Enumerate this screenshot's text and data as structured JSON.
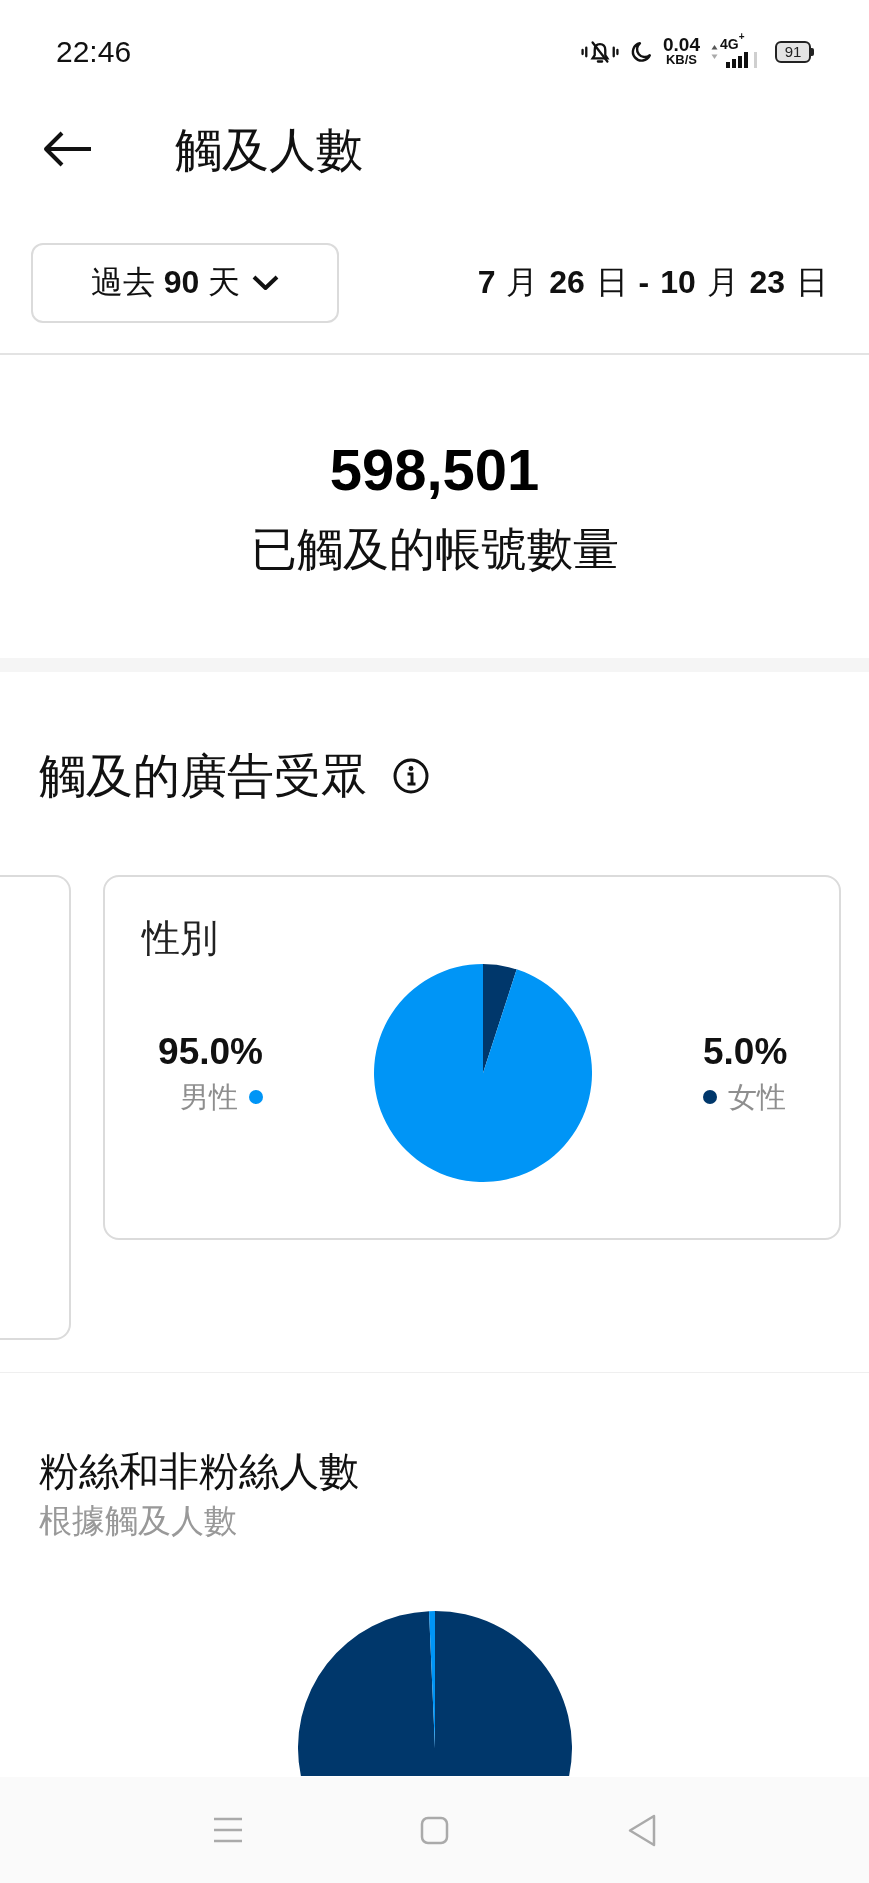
{
  "status_bar": {
    "time": "22:46",
    "speed": "0.04",
    "speed_unit": "KB/S",
    "network": "4G$^{+}$",
    "battery": "91"
  },
  "header": {
    "title": "觸及人數"
  },
  "filter": {
    "range": "過去 **90** 天",
    "dates": "**7** 月 **26** 日 **-** **10** 月 **23** 日"
  },
  "summary": {
    "value": "598,501",
    "label": "已觸及的帳號數量"
  },
  "audience": {
    "title": "觸及的廣告受眾",
    "gender": {
      "title": "性別",
      "chart_data": {
        "type": "pie",
        "categories": [
          "男性",
          "女性"
        ],
        "values": [
          95.0,
          5.0
        ],
        "value_labels": [
          "95.0%",
          "5.0%"
        ],
        "colors": [
          "#0095f6",
          "#00376b"
        ]
      }
    }
  },
  "followers": {
    "title": "粉絲和非粉絲人數",
    "subtitle": "根據觸及人數"
  }
}
